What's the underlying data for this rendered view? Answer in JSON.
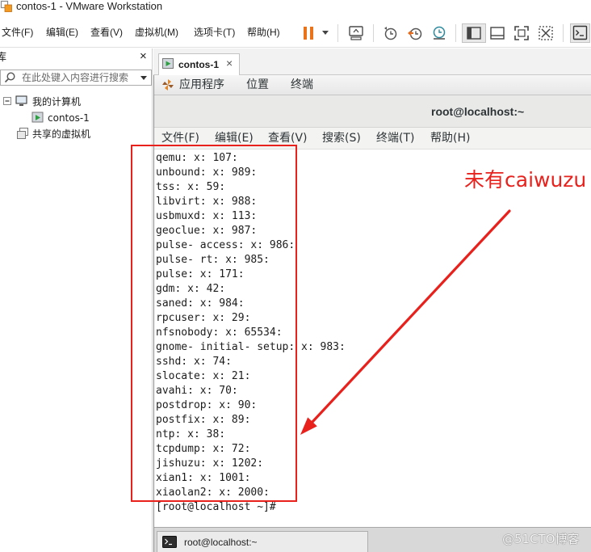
{
  "window": {
    "title": "contos-1 - VMware Workstation"
  },
  "menu": {
    "items": [
      "文件(F)",
      "编辑(E)",
      "查看(V)",
      "虚拟机(M)",
      "选项卡(T)",
      "帮助(H)"
    ]
  },
  "toolbar": {
    "icons": [
      "pause-icon",
      "dropdown-arrow-icon",
      "send-ctrl-alt-del-icon",
      "snapshot-take-icon",
      "snapshot-revert-icon",
      "snapshot-manager-icon",
      "library-view-icon",
      "console-view-icon",
      "fullscreen-icon",
      "unity-icon",
      "terminal-icon"
    ],
    "pause_color": "#e8731a"
  },
  "library": {
    "title": "库",
    "close": "×",
    "search_placeholder": "在此处键入内容进行搜索",
    "tree": {
      "my_computer": "我的计算机",
      "vm": "contos-1",
      "shared": "共享的虚拟机"
    }
  },
  "tab": {
    "label": "contos-1",
    "close": "×"
  },
  "gnome": {
    "items": [
      "应用程序",
      "位置",
      "终端"
    ]
  },
  "terminal": {
    "title": "root@localhost:~",
    "menu": [
      "文件(F)",
      "编辑(E)",
      "查看(V)",
      "搜索(S)",
      "终端(T)",
      "帮助(H)"
    ],
    "lines": [
      "qemu: x: 107:",
      "unbound: x: 989:",
      "tss: x: 59:",
      "libvirt: x: 988:",
      "usbmuxd: x: 113:",
      "geoclue: x: 987:",
      "pulse- access: x: 986:",
      "pulse- rt: x: 985:",
      "pulse: x: 171:",
      "gdm: x: 42:",
      "saned: x: 984:",
      "rpcuser: x: 29:",
      "nfsnobody: x: 65534:",
      "gnome- initial- setup: x: 983:",
      "sshd: x: 74:",
      "slocate: x: 21:",
      "avahi: x: 70:",
      "postdrop: x: 90:",
      "postfix: x: 89:",
      "ntp: x: 38:",
      "tcpdump: x: 72:",
      "jishuzu: x: 1202:",
      "xian1: x: 1001:",
      "xiaolan2: x: 2000:"
    ],
    "prompt": "[root@localhost ~]#"
  },
  "annotation": {
    "text": "未有caiwuzu",
    "color": "#e8211c"
  },
  "taskbar": {
    "item": "root@localhost:~"
  },
  "watermark": "@51CTO博客"
}
